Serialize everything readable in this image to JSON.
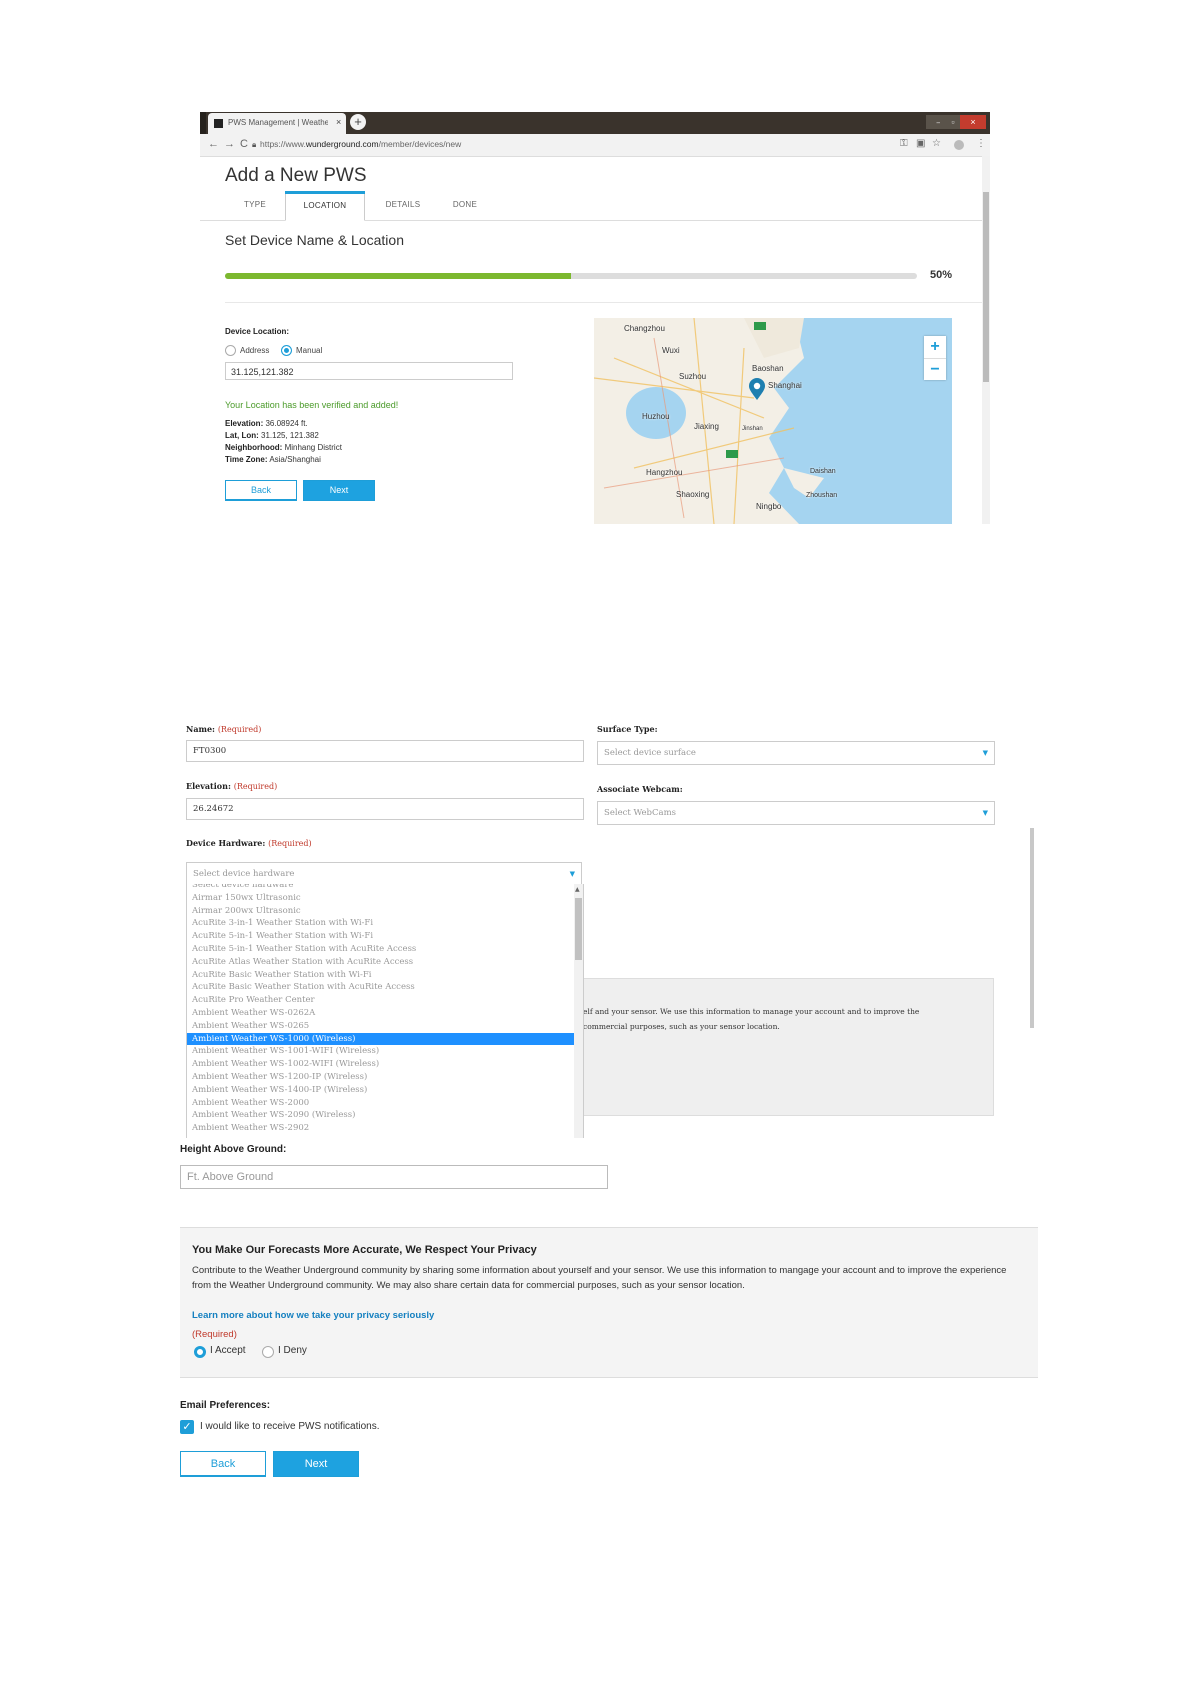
{
  "browser": {
    "tab_title": "PWS Management | Weather",
    "tab_close": "×",
    "new_tab": "+",
    "url_prefix": "https://www.",
    "url_domain": "wunderground.com",
    "url_path": "/member/devices/new",
    "back": "←",
    "forward": "→",
    "reload": "C",
    "key_icon": "⚿",
    "star_icon": "☆",
    "menu_icon": "⋮"
  },
  "step_page": {
    "title": "Add a New PWS",
    "tabs": [
      {
        "label": "TYPE",
        "active": false
      },
      {
        "label": "LOCATION",
        "active": true
      },
      {
        "label": "DETAILS",
        "active": false
      },
      {
        "label": "DONE",
        "active": false
      }
    ],
    "section_title": "Set Device Name & Location",
    "progress_percent": 50,
    "progress_label": "50%",
    "device_location_label": "Device Location:",
    "radio_address": "Address",
    "radio_manual": "Manual",
    "coordinates_value": "31.125,121.382",
    "verified_message": "Your Location has been verified and added!",
    "elevation_label": "Elevation:",
    "elevation_value": "36.08924 ft.",
    "latlon_label": "Lat, Lon:",
    "latlon_value": "31.125, 121.382",
    "neighborhood_label": "Neighborhood:",
    "neighborhood_value": "Minhang District",
    "timezone_label": "Time Zone:",
    "timezone_value": "Asia/Shanghai",
    "back_button": "Back",
    "next_button": "Next",
    "map": {
      "labels": [
        "Changzhou",
        "Wuxi",
        "Suzhou",
        "Baoshan",
        "Shanghai",
        "Huzhou",
        "Jiaxing",
        "Jinshan",
        "Hangzhou",
        "Shaoxing",
        "Ningbo",
        "Daishan",
        "Zhoushan"
      ],
      "zoom_in": "+",
      "zoom_out": "−"
    }
  },
  "details_form": {
    "name_label": "Name:",
    "required_tag": "(Required)",
    "name_value": "FT0300",
    "surface_type_label": "Surface Type:",
    "surface_type_placeholder": "Select device surface",
    "elevation_label": "Elevation:",
    "elevation_value": "26.24672",
    "associate_webcam_label": "Associate Webcam:",
    "webcam_placeholder": "Select WebCams",
    "device_hardware_label": "Device Hardware:",
    "hardware_placeholder": "Select device hardware",
    "hardware_options": [
      "Select device hardware",
      "Airmar 150wx Ultrasonic",
      "Airmar 200wx Ultrasonic",
      "AcuRite 3-in-1 Weather Station with Wi-Fi",
      "AcuRite 5-in-1 Weather Station with Wi-Fi",
      "AcuRite 5-in-1 Weather Station with AcuRite Access",
      "AcuRite Atlas Weather Station with AcuRite Access",
      "AcuRite Basic Weather Station with Wi-Fi",
      "AcuRite Basic Weather Station with AcuRite Access",
      "AcuRite Pro Weather Center",
      "Ambient Weather WS-0262A",
      "Ambient Weather WS-0265",
      "Ambient Weather WS-1000 (Wireless)",
      "Ambient Weather WS-1001-WIFI (Wireless)",
      "Ambient Weather WS-1002-WIFI (Wireless)",
      "Ambient Weather WS-1200-IP (Wireless)",
      "Ambient Weather WS-1400-IP (Wireless)",
      "Ambient Weather WS-2000",
      "Ambient Weather WS-2090 (Wireless)",
      "Ambient Weather WS-2902"
    ],
    "selected_index": 12,
    "privacy_partial_line1": "elf and your sensor. We use this information to manage your account and to improve the",
    "privacy_partial_line2": "commercial purposes, such as your sensor location."
  },
  "final_section": {
    "height_label": "Height Above Ground:",
    "height_placeholder": "Ft. Above Ground",
    "privacy_heading": "You Make Our Forecasts More Accurate, We Respect Your Privacy",
    "privacy_body": "Contribute to the Weather Underground community by sharing some information about yourself and your sensor. We use this information to mangage your account and to improve the experience from the Weather Underground community. We may also share certain data for commercial purposes, such as your sensor location.",
    "privacy_link": "Learn more about how we take your privacy seriously",
    "required": "(Required)",
    "accept_label": "I Accept",
    "deny_label": "I Deny",
    "email_pref_label": "Email Preferences:",
    "notify_label": "I would like to receive PWS notifications.",
    "checkmark": "✓",
    "back_button": "Back",
    "next_button": "Next"
  },
  "colors": {
    "accent": "#1e9ed8",
    "progress": "#7cb82f",
    "required": "#c0392b",
    "verified": "#4b9b2a"
  }
}
